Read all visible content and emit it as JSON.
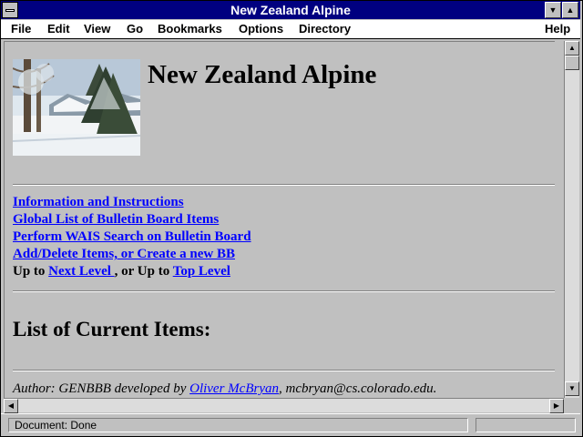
{
  "window": {
    "title": "New Zealand Alpine"
  },
  "menubar": {
    "file": "File",
    "edit": "Edit",
    "view": "View",
    "go": "Go",
    "bookmarks": "Bookmarks",
    "options": "Options",
    "directory": "Directory",
    "help": "Help"
  },
  "page": {
    "heading": "New Zealand Alpine",
    "links": [
      "Information and Instructions",
      "Global List of Bulletin Board Items",
      "Perform WAIS Search on Bulletin Board",
      "Add/Delete Items, or Create a new BB"
    ],
    "up_prefix": "Up to ",
    "next_level": "Next Level ",
    "up_mid": ", or Up to ",
    "top_level": "Top Level ",
    "subheading": "List of Current Items:",
    "author_prefix": "Author: GENBBB developed by ",
    "author_name": "Oliver McBryan",
    "author_suffix": ", mcbryan@cs.colorado.edu."
  },
  "status": {
    "text": "Document: Done"
  },
  "colors": {
    "titlebar": "#000080",
    "link": "#0000ff",
    "chrome": "#c0c0c0"
  },
  "icons": [
    "system-menu-icon",
    "minimize-icon",
    "maximize-icon",
    "scroll-up-icon",
    "scroll-down-icon",
    "scroll-left-icon",
    "scroll-right-icon"
  ]
}
